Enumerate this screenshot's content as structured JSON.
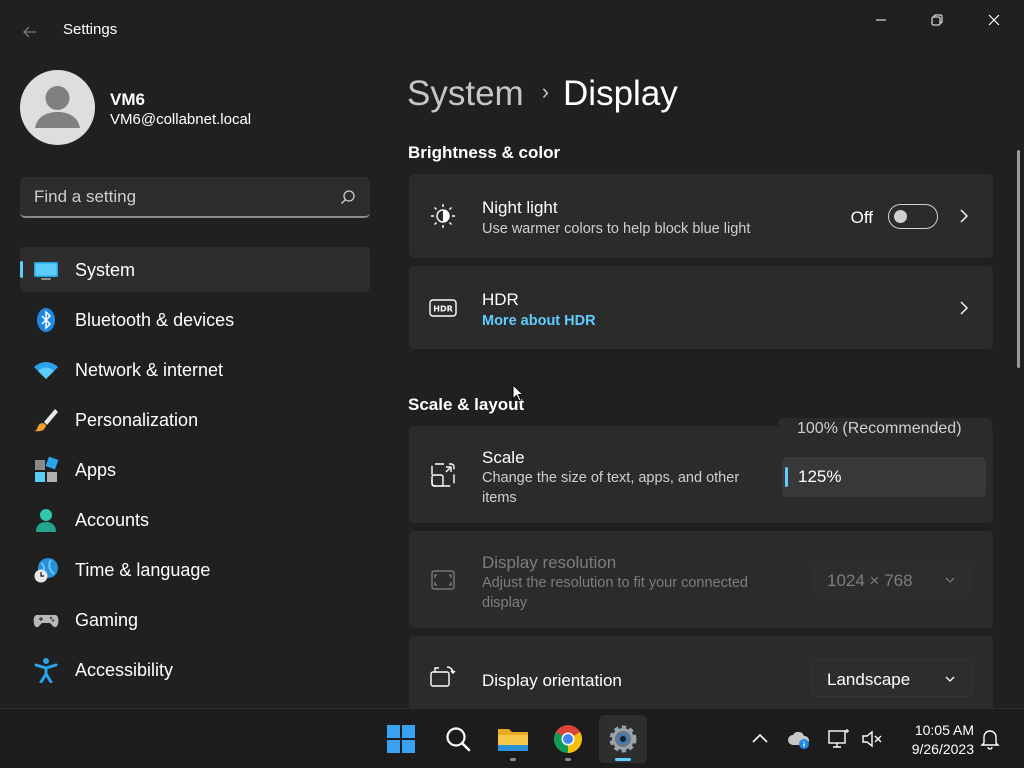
{
  "titlebar": {
    "app_title": "Settings",
    "back_icon": "back-arrow-icon",
    "minimize_icon": "minimize-icon",
    "restore_icon": "restore-icon",
    "close_icon": "close-icon"
  },
  "profile": {
    "name": "VM6",
    "email": "VM6@collabnet.local",
    "avatar_icon": "user-avatar-icon"
  },
  "search": {
    "placeholder": "Find a setting",
    "icon": "search-icon"
  },
  "nav": {
    "items": [
      {
        "label": "System",
        "icon": "system-display-icon",
        "active": true
      },
      {
        "label": "Bluetooth & devices",
        "icon": "bluetooth-icon",
        "active": false
      },
      {
        "label": "Network & internet",
        "icon": "wifi-icon",
        "active": false
      },
      {
        "label": "Personalization",
        "icon": "paintbrush-icon",
        "active": false
      },
      {
        "label": "Apps",
        "icon": "apps-icon",
        "active": false
      },
      {
        "label": "Accounts",
        "icon": "accounts-icon",
        "active": false
      },
      {
        "label": "Time & language",
        "icon": "time-language-icon",
        "active": false
      },
      {
        "label": "Gaming",
        "icon": "gamepad-icon",
        "active": false
      },
      {
        "label": "Accessibility",
        "icon": "accessibility-icon",
        "active": false
      }
    ]
  },
  "breadcrumb": {
    "parent": "System",
    "separator": "›",
    "current": "Display"
  },
  "sections": {
    "brightness_color": "Brightness & color",
    "scale_layout": "Scale & layout"
  },
  "night_light": {
    "title": "Night light",
    "subtitle": "Use warmer colors to help block blue light",
    "toggle_label": "Off",
    "toggle_on": false,
    "icon": "brightness-icon"
  },
  "hdr": {
    "title": "HDR",
    "link": "More about HDR",
    "icon": "hdr-icon"
  },
  "scale": {
    "title": "Scale",
    "subtitle": "Change the size of text, apps, and other items",
    "icon": "scale-icon",
    "options_visible": [
      "100% (Recommended)",
      "125%"
    ],
    "selected": "125%"
  },
  "resolution": {
    "title": "Display resolution",
    "subtitle": "Adjust the resolution to fit your connected display",
    "value": "1024 × 768",
    "disabled": true,
    "icon": "resolution-icon"
  },
  "orientation": {
    "title": "Display orientation",
    "value": "Landscape",
    "icon": "orientation-icon"
  },
  "taskbar": {
    "apps": [
      {
        "name": "start",
        "icon": "windows-start-icon"
      },
      {
        "name": "search",
        "icon": "search-icon"
      },
      {
        "name": "file-explorer",
        "icon": "folder-icon"
      },
      {
        "name": "chrome",
        "icon": "chrome-icon"
      },
      {
        "name": "settings",
        "icon": "gear-icon",
        "active": true
      }
    ],
    "tray": [
      "chevron-up-icon",
      "onedrive-cloud-icon",
      "network-monitor-icon",
      "volume-muted-icon",
      "notification-bell-icon"
    ],
    "time": "10:05 AM",
    "date": "9/26/2023"
  },
  "colors": {
    "accent": "#60cdff",
    "background": "#202020",
    "card": "#2b2b2b",
    "taskbar": "#1c1c1c"
  }
}
